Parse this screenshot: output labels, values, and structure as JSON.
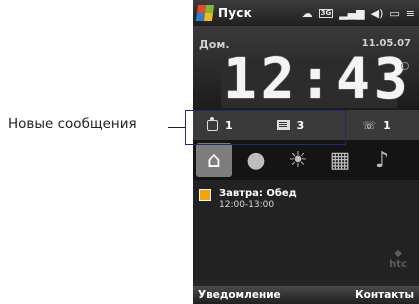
{
  "callout": {
    "label": "Новые сообщения"
  },
  "titlebar": {
    "title": "Пуск",
    "icons": [
      "sync-icon",
      "3g-icon",
      "signal-icon",
      "speaker-icon",
      "battery-icon",
      "menu-icon"
    ]
  },
  "home": {
    "location": "Дом.",
    "date": "11.05.07",
    "time": "12:43"
  },
  "notifications": {
    "sms": "1",
    "mail": "3",
    "missed_calls": "1"
  },
  "tabs": [
    "home-icon",
    "contact-icon",
    "weather-icon",
    "programs-icon",
    "music-icon"
  ],
  "calendar": {
    "title": "Завтра: Обед",
    "time": "12:00-13:00"
  },
  "softkeys": {
    "left": "Уведомление",
    "right": "Контакты"
  },
  "logo": {
    "text": "htc"
  }
}
